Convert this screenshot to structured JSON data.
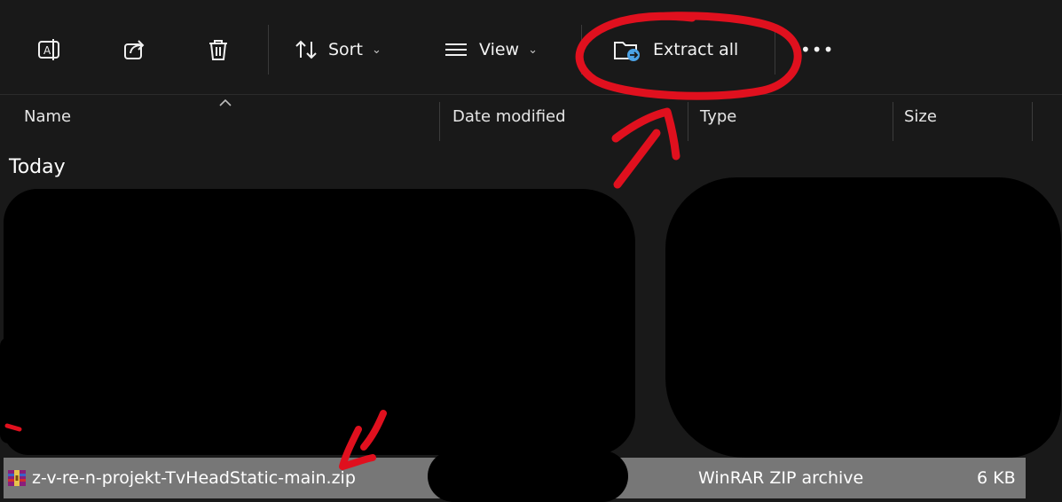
{
  "toolbar": {
    "sort_label": "Sort",
    "view_label": "View",
    "extract_label": "Extract all",
    "more_label": "•••"
  },
  "columns": {
    "name": "Name",
    "date_modified": "Date modified",
    "type": "Type",
    "size": "Size"
  },
  "group_header": "Today",
  "selected_file": {
    "name": "z-v-re-n-projekt-TvHeadStatic-main.zip",
    "type": "WinRAR ZIP archive",
    "size": "6 KB"
  },
  "colors": {
    "background": "#191919",
    "selected_row": "#777777",
    "annotation_red": "#e0101e",
    "extract_icon_accent": "#4ca3e6"
  }
}
